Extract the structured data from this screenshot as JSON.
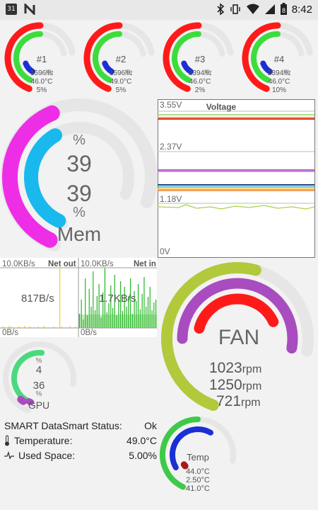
{
  "status_bar": {
    "calendar_day": "31",
    "time": "8:42",
    "battery": "8"
  },
  "cpu_cores": [
    {
      "label": "#1",
      "freq": "1596",
      "freq_unit": "㎒",
      "temp": "46.0°C",
      "load": "5%"
    },
    {
      "label": "#2",
      "freq": "1596",
      "freq_unit": "㎒",
      "temp": "49.0°C",
      "load": "5%"
    },
    {
      "label": "#3",
      "freq": "2394",
      "freq_unit": "㎒",
      "temp": "46.0°C",
      "load": "2%"
    },
    {
      "label": "#4",
      "freq": "2394",
      "freq_unit": "㎒",
      "temp": "46.0°C",
      "load": "10%"
    }
  ],
  "memory": {
    "unit_top": "%",
    "value1": "39",
    "value2": "39",
    "unit_bottom": "%",
    "label": "Mem",
    "level_outer": 0.39,
    "level_inner": 0.39
  },
  "voltage": {
    "title": "Voltage",
    "labels": [
      "3.55V",
      "2.37V",
      "1.18V",
      "0V"
    ]
  },
  "network": {
    "out": {
      "scale": "10.0KB/s",
      "title": "Net out",
      "value": "817B/s",
      "zero": "0B/s"
    },
    "in": {
      "scale": "10.0KB/s",
      "title": "Net in",
      "value": "1.7KB/s",
      "zero": "0B/s"
    }
  },
  "fan": {
    "label": "FAN",
    "rpm1": "1023",
    "rpm2": "1250",
    "rpm3": "721",
    "unit": "rpm"
  },
  "gpu": {
    "unit_top": "%",
    "value1": "4",
    "value2": "36",
    "unit_bottom": "%",
    "label": "GPU"
  },
  "smart": {
    "title": "SMART DataSmart Status:",
    "status": "Ok",
    "temp_label": "Temperature:",
    "temp_value": "49.0°C",
    "space_label": "Used Space:",
    "space_value": "5.00%"
  },
  "temp_gauge": {
    "label": "Temp",
    "values": [
      "44.0°C",
      "2.50°C",
      "41.0°C"
    ]
  },
  "colors": {
    "red": "#ff1a1a",
    "green": "#3ddc3d",
    "blue": "#1a2fd6",
    "magenta": "#ee2ee6",
    "cyan": "#19b9ee",
    "olive": "#b2c93c",
    "purple": "#a94cc0",
    "grey_track": "#e6e6e6"
  }
}
